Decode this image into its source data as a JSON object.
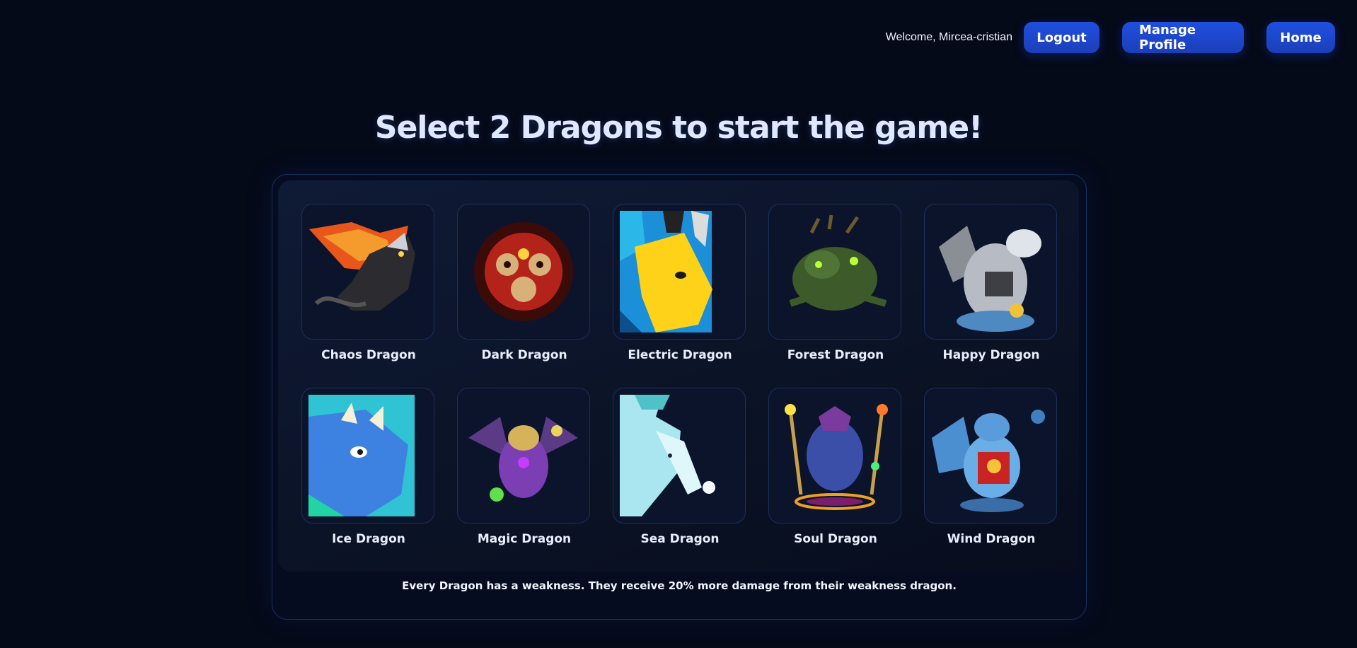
{
  "header": {
    "welcome": "Welcome, Mircea-cristian",
    "buttons": {
      "logout": "Logout",
      "manage_profile": "Manage Profile",
      "home": "Home"
    }
  },
  "title": "Select 2 Dragons to start the game!",
  "dragons": [
    {
      "label": "Chaos Dragon"
    },
    {
      "label": "Dark Dragon"
    },
    {
      "label": "Electric Dragon"
    },
    {
      "label": "Forest Dragon"
    },
    {
      "label": "Happy Dragon"
    },
    {
      "label": "Ice Dragon"
    },
    {
      "label": "Magic Dragon"
    },
    {
      "label": "Sea Dragon"
    },
    {
      "label": "Soul Dragon"
    },
    {
      "label": "Wind Dragon"
    }
  ],
  "footnote": "Every Dragon has a weakness. They receive 20% more damage from their weakness dragon.",
  "colors": {
    "background": "#050a19",
    "button": "#1f4fe0",
    "card_border": "#1e2f5b"
  }
}
